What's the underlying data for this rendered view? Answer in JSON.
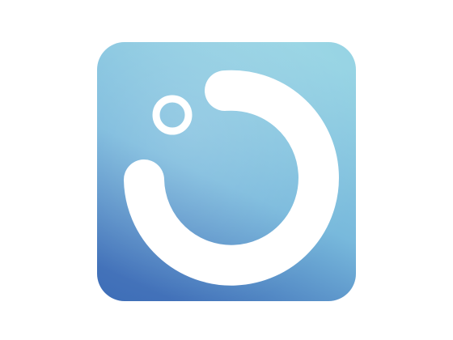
{
  "icon": {
    "name": "app-icon",
    "colors": {
      "gradient_top": "#97d4e4",
      "gradient_mid": "#78b9dc",
      "gradient_bottom": "#3f6fb8",
      "glyph": "#ffffff"
    }
  }
}
